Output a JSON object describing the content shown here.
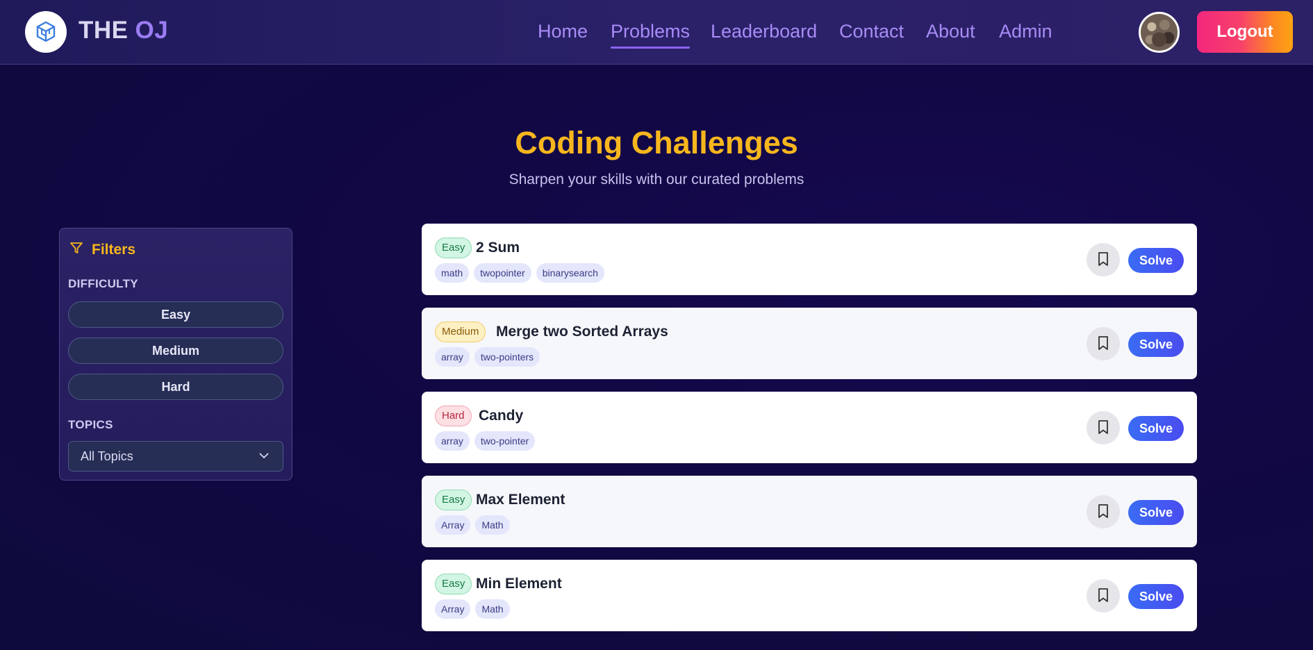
{
  "brand": {
    "part1": "THE",
    "part2": "OJ"
  },
  "nav": {
    "items": [
      {
        "label": "Home"
      },
      {
        "label": "Problems"
      },
      {
        "label": "Leaderboard"
      },
      {
        "label": "Contact"
      },
      {
        "label": "About"
      },
      {
        "label": "Admin"
      }
    ],
    "active": "Problems",
    "logout_label": "Logout"
  },
  "header": {
    "title": "Coding Challenges",
    "subtitle": "Sharpen your skills with our curated problems"
  },
  "filters": {
    "title": "Filters",
    "difficulty_label": "DIFFICULTY",
    "difficulty_options": [
      "Easy",
      "Medium",
      "Hard"
    ],
    "topics_label": "TOPICS",
    "topics_selected": "All Topics"
  },
  "problems": [
    {
      "difficulty": "Easy",
      "title": "2 Sum",
      "tags": [
        "math",
        "twopointer",
        "binarysearch"
      ],
      "solve_label": "Solve"
    },
    {
      "difficulty": "Medium",
      "title": "Merge two Sorted Arrays",
      "tags": [
        "array",
        "two-pointers"
      ],
      "solve_label": "Solve"
    },
    {
      "difficulty": "Hard",
      "title": "Candy",
      "tags": [
        "array",
        "two-pointer"
      ],
      "solve_label": "Solve"
    },
    {
      "difficulty": "Easy",
      "title": "Max Element",
      "tags": [
        "Array",
        "Math"
      ],
      "solve_label": "Solve"
    },
    {
      "difficulty": "Easy",
      "title": "Min Element",
      "tags": [
        "Array",
        "Math"
      ],
      "solve_label": "Solve"
    }
  ],
  "colors": {
    "accent_yellow": "#f7b61d",
    "nav_purple": "#a88cf5",
    "solve_blue": "#3a6cf4",
    "easy_green": "#167a46",
    "medium_amber": "#8a5a06",
    "hard_red": "#b4263b"
  },
  "icons": {
    "logo": "cube-logo-icon",
    "filter": "funnel-icon",
    "select": "chevron-down-icon",
    "bookmark": "bookmark-icon"
  }
}
